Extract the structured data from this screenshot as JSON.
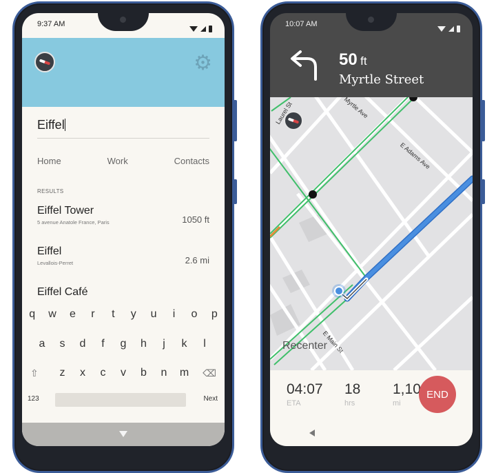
{
  "left_phone": {
    "status": {
      "time": "9:37 AM"
    },
    "header": {
      "compass_icon": "compass-icon",
      "settings_icon": "gear-icon"
    },
    "search": {
      "value": "Eiffel"
    },
    "quick_links": [
      "Home",
      "Work",
      "Contacts"
    ],
    "results_label": "RESULTS",
    "results": [
      {
        "name": "Eiffel Tower",
        "address": "5 avenue Anatole France, Paris",
        "distance": "1050 ft"
      },
      {
        "name": "Eiffel",
        "address": "Levallois-Perret",
        "distance": "2.6 mi"
      },
      {
        "name": "Eiffel Café",
        "address": "",
        "distance": ""
      }
    ],
    "keyboard": {
      "row1": [
        "q",
        "w",
        "e",
        "r",
        "t",
        "y",
        "u",
        "i",
        "o",
        "p"
      ],
      "row2": [
        "a",
        "s",
        "d",
        "f",
        "g",
        "h",
        "j",
        "k",
        "l"
      ],
      "row3": [
        "z",
        "x",
        "c",
        "v",
        "b",
        "n",
        "m"
      ],
      "mode_key": "123",
      "next_key": "Next",
      "shift_icon": "shift-icon",
      "backspace_icon": "backspace-icon"
    }
  },
  "right_phone": {
    "status": {
      "time": "10:07 AM"
    },
    "instruction": {
      "distance": "50",
      "unit": "ft",
      "street": "Myrtle Street",
      "turn_icon": "turn-left-icon"
    },
    "map": {
      "street_labels": [
        "Laurel St",
        "Myrtle Ave",
        "E Adams Ave",
        "E Main St"
      ],
      "recenter_label": "Recenter",
      "colors": {
        "route": "#4a8fe0",
        "traffic": "#3fbf6a",
        "road": "#ffffff",
        "block": "#d2d2d4"
      }
    },
    "trip": {
      "eta_value": "04:07",
      "eta_label": "ETA",
      "hours_value": "18",
      "hours_label": "hrs",
      "miles_value": "1,10",
      "miles_label": "mi",
      "end_label": "END",
      "end_color": "#d65a5d"
    }
  }
}
